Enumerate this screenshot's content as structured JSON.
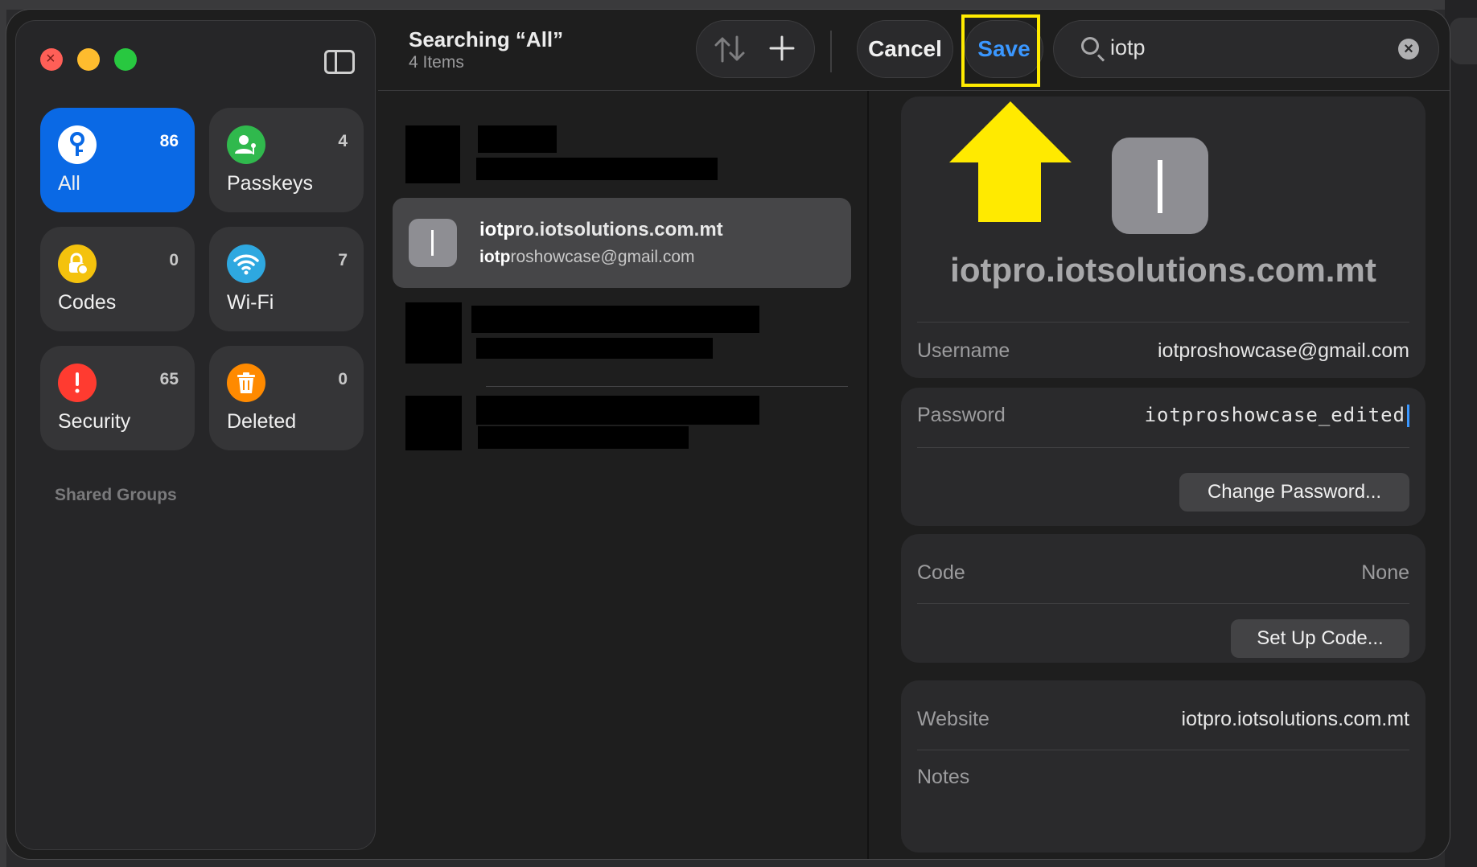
{
  "window": {
    "traffic_lights": [
      "close",
      "minimize",
      "maximize"
    ]
  },
  "sidebar": {
    "tiles": [
      {
        "label": "All",
        "count": "86",
        "icon": "key-icon",
        "color": "#0a69e5",
        "active": true
      },
      {
        "label": "Passkeys",
        "count": "4",
        "icon": "passkey-person-icon",
        "color": "#30b94d"
      },
      {
        "label": "Codes",
        "count": "0",
        "icon": "lock-clock-icon",
        "color": "#f4c20d"
      },
      {
        "label": "Wi-Fi",
        "count": "7",
        "icon": "wifi-icon",
        "color": "#2ea8e0"
      },
      {
        "label": "Security",
        "count": "65",
        "icon": "exclamation-icon",
        "color": "#ff3b30"
      },
      {
        "label": "Deleted",
        "count": "0",
        "icon": "trash-icon",
        "color": "#ff8a00"
      }
    ],
    "shared_groups": "Shared Groups"
  },
  "toolbar": {
    "title": "Searching “All”",
    "subtitle": "4 Items",
    "cancel": "Cancel",
    "save": "Save",
    "search_value": "iotp"
  },
  "list": {
    "selected": {
      "title_match": "iotp",
      "title_rest": "ro.iotsolutions.com.mt",
      "sub_match": "iotp",
      "sub_rest": "roshowcase@gmail.com"
    }
  },
  "detail": {
    "title": "iotpro.iotsolutions.com.mt",
    "username_label": "Username",
    "username_value": "iotproshowcase@gmail.com",
    "password_label": "Password",
    "password_value": "iotproshowcase_edited",
    "change_password": "Change Password...",
    "code_label": "Code",
    "code_value": "None",
    "setup_code": "Set Up Code...",
    "website_label": "Website",
    "website_value": "iotpro.iotsolutions.com.mt",
    "notes_label": "Notes"
  },
  "colors": {
    "accent": "#3a97ff",
    "highlight": "#ffea00"
  }
}
